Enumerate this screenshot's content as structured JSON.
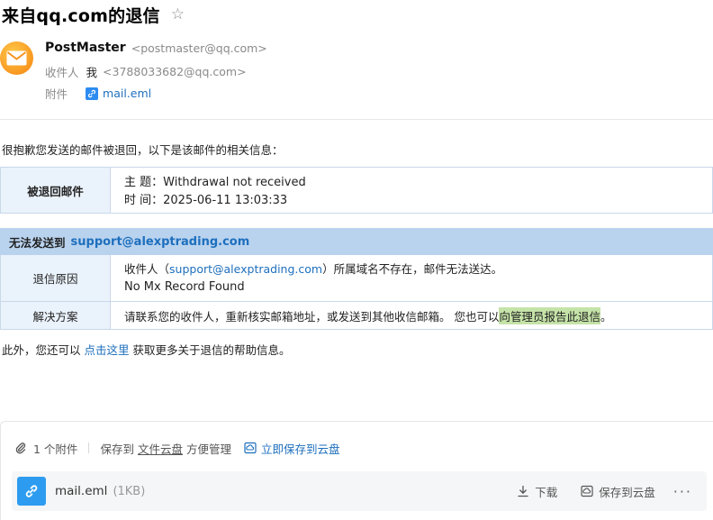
{
  "email": {
    "subject_title": "来自qq.com的退信",
    "sender_name": "PostMaster",
    "sender_addr": "<postmaster@qq.com>",
    "to_label": "收件人",
    "to_name": "我",
    "to_addr": "<3788033682@qq.com>",
    "attach_label": "附件",
    "attach_file": "mail.eml"
  },
  "body": {
    "intro": "很抱歉您发送的邮件被退回，以下是该邮件的相关信息：",
    "bounced": {
      "label": "被退回邮件",
      "subject_line": "主 题：Withdrawal not received",
      "time_line": "时 间：2025-06-11 13:03:33"
    },
    "undeliverable": {
      "prefix": "无法发送到",
      "address": "support@alexptrading.com",
      "reason_label": "退信原因",
      "reason_pre": "收件人（",
      "reason_addr": "support@alexptrading.com",
      "reason_post": "）所属域名不存在，邮件无法送达。",
      "reason_detail": "No Mx Record Found",
      "solution_label": "解决方案",
      "solution_text": "请联系您的收件人，重新核实邮箱地址，或发送到其他收信邮箱。 您也可以",
      "solution_highlight": "向管理员报告此退信",
      "solution_end": "。"
    },
    "footer_pre": "此外，您还可以",
    "footer_link": "点击这里",
    "footer_post": "获取更多关于退信的帮助信息。"
  },
  "attachments": {
    "count_text": "1 个附件",
    "save_pre": "保存到",
    "save_link": "文件云盘",
    "save_post": "方便管理",
    "save_now": "立即保存到云盘",
    "file_name": "mail.eml",
    "file_size": "(1KB)",
    "download": "下载",
    "save_cloud": "保存到云盘",
    "more": "···"
  },
  "colors": {
    "link": "#1e6fbd",
    "table_header": "#b9d3ef",
    "table_label_bg": "#eaf2fb",
    "highlight": "#c5e3a8"
  }
}
